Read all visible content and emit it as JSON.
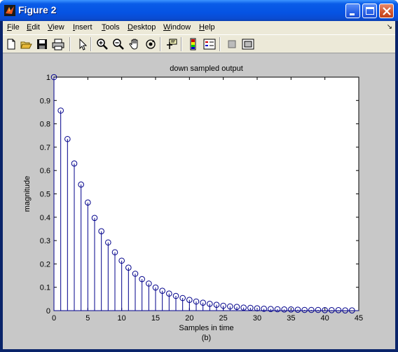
{
  "window": {
    "title": "Figure 2",
    "buttons": [
      "minimize",
      "maximize",
      "close"
    ]
  },
  "menu": {
    "items": [
      {
        "label": "File",
        "u": "F",
        "rest": "ile"
      },
      {
        "label": "Edit",
        "u": "E",
        "rest": "dit"
      },
      {
        "label": "View",
        "u": "V",
        "rest": "iew"
      },
      {
        "label": "Insert",
        "u": "I",
        "rest": "nsert"
      },
      {
        "label": "Tools",
        "u": "T",
        "rest": "ools"
      },
      {
        "label": "Desktop",
        "u": "D",
        "rest": "esktop"
      },
      {
        "label": "Window",
        "u": "W",
        "rest": "indow"
      },
      {
        "label": "Help",
        "u": "H",
        "rest": "elp"
      }
    ],
    "dock_arrow": "↘"
  },
  "toolbar": {
    "tools": [
      "new-figure-icon",
      "open-file-icon",
      "save-icon",
      "print-icon",
      "edit-plot-arrow-icon",
      "zoom-in-icon",
      "zoom-out-icon",
      "pan-hand-icon",
      "rotate-3d-icon",
      "data-cursor-icon",
      "colorbar-icon",
      "legend-icon",
      "hide-plot-tools-icon",
      "show-plot-tools-icon"
    ]
  },
  "chart_data": {
    "type": "stem",
    "title": "down sampled output",
    "xlabel": "Samples in time",
    "ylabel": "magnitude",
    "caption": "(b)",
    "xlim": [
      0,
      45
    ],
    "ylim": [
      0,
      1
    ],
    "xticks": [
      0,
      5,
      10,
      15,
      20,
      25,
      30,
      35,
      40,
      45
    ],
    "yticks": [
      0,
      0.1,
      0.2,
      0.3,
      0.4,
      0.5,
      0.6,
      0.7,
      0.8,
      0.9,
      1
    ],
    "ytick_labels": [
      "0",
      "0.1",
      "0.2",
      "0.3",
      "0.4",
      "0.5",
      "0.6",
      "0.7",
      "0.8",
      "0.9",
      "1"
    ],
    "grid": false,
    "series_color": "#00008b",
    "x": [
      0,
      1,
      2,
      3,
      4,
      5,
      6,
      7,
      8,
      9,
      10,
      11,
      12,
      13,
      14,
      15,
      16,
      17,
      18,
      19,
      20,
      21,
      22,
      23,
      24,
      25,
      26,
      27,
      28,
      29,
      30,
      31,
      32,
      33,
      34,
      35,
      36,
      37,
      38,
      39,
      40,
      41,
      42,
      43,
      44
    ],
    "values": [
      1.0,
      0.857,
      0.735,
      0.63,
      0.54,
      0.463,
      0.397,
      0.34,
      0.292,
      0.25,
      0.214,
      0.184,
      0.158,
      0.135,
      0.116,
      0.099,
      0.085,
      0.073,
      0.063,
      0.054,
      0.046,
      0.039,
      0.034,
      0.029,
      0.025,
      0.021,
      0.018,
      0.016,
      0.013,
      0.012,
      0.01,
      0.008,
      0.007,
      0.006,
      0.005,
      0.005,
      0.004,
      0.003,
      0.003,
      0.003,
      0.002,
      0.002,
      0.002,
      0.001,
      0.001
    ]
  }
}
